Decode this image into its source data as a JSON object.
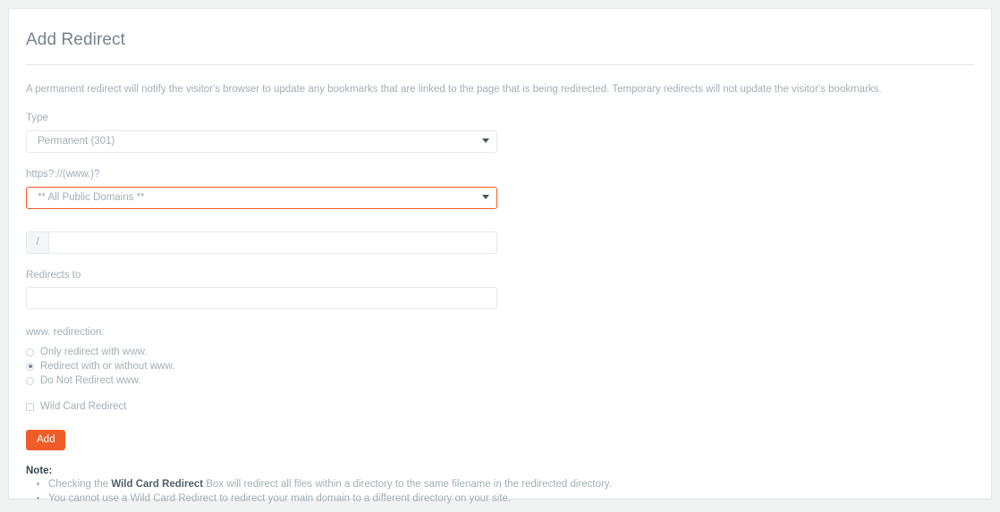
{
  "card": {
    "title": "Add Redirect",
    "intro": "A permanent redirect will notify the visitor's browser to update any bookmarks that are linked to the page that is being redirected. Temporary redirects will not update the visitor's bookmarks."
  },
  "form": {
    "type_label": "Type",
    "type_value": "Permanent (301)",
    "domain_label": "https?://(www.)?",
    "domain_value": "** All Public Domains **",
    "path_prefix": "/",
    "path_value": "",
    "path_placeholder": "",
    "redirects_to_label": "Redirects to",
    "redirects_to_value": "",
    "redirects_to_placeholder": "",
    "www_group_label": "www. redirection:",
    "radios": [
      {
        "label": "Only redirect with www.",
        "checked": false
      },
      {
        "label": "Redirect with or without www.",
        "checked": true
      },
      {
        "label": "Do Not Redirect www.",
        "checked": false
      }
    ],
    "wildcard_label": "Wild Card Redirect",
    "wildcard_checked": false,
    "submit_label": "Add"
  },
  "note": {
    "title": "Note:",
    "items": [
      {
        "pre": "Checking the ",
        "bold": "Wild Card Redirect",
        "post": " Box will redirect all files within a directory to the same filename in the redirected directory."
      },
      {
        "pre": "You cannot use a Wild Card Redirect to redirect your main domain to a different directory on your site.",
        "bold": "",
        "post": ""
      }
    ]
  },
  "colors": {
    "accent": "#ef5c28",
    "focus_border": "#f05b28",
    "page_bg": "#f1f2f2",
    "card_bg": "#ffffff",
    "muted_text": "#a3afb7",
    "title_text": "#76838f"
  }
}
